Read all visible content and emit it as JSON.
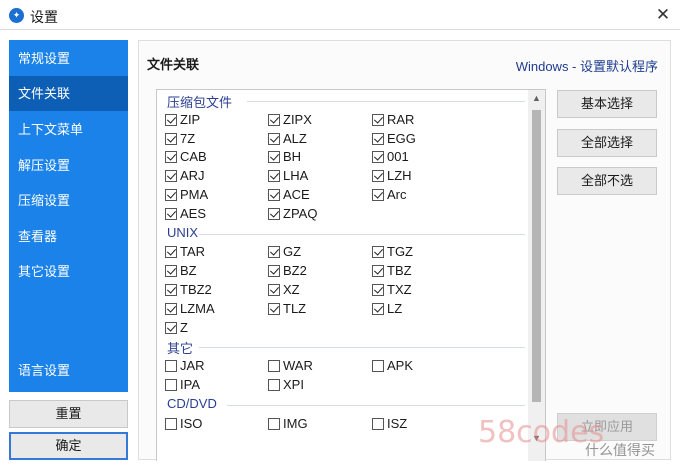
{
  "window": {
    "title": "设置",
    "close_glyph": "✕",
    "app_icon_glyph": "✦"
  },
  "sidebar": {
    "items": [
      {
        "label": "常规设置",
        "active": false
      },
      {
        "label": "文件关联",
        "active": true
      },
      {
        "label": "上下文菜单",
        "active": false
      },
      {
        "label": "解压设置",
        "active": false
      },
      {
        "label": "压缩设置",
        "active": false
      },
      {
        "label": "查看器",
        "active": false
      },
      {
        "label": "其它设置",
        "active": false
      }
    ],
    "language": "语言设置"
  },
  "buttons": {
    "reset": "重置",
    "ok": "确定",
    "basic_select": "基本选择",
    "select_all": "全部选择",
    "select_none": "全部不选",
    "apply": "立即应用"
  },
  "panel": {
    "title": "文件关联",
    "windows_link": "Windows - 设置默认程序"
  },
  "groups": [
    {
      "name": "压缩包文件",
      "items": [
        [
          "ZIP",
          true
        ],
        [
          "ZIPX",
          true
        ],
        [
          "RAR",
          true
        ],
        [
          "7Z",
          true
        ],
        [
          "ALZ",
          true
        ],
        [
          "EGG",
          true
        ],
        [
          "CAB",
          true
        ],
        [
          "BH",
          true
        ],
        [
          "001",
          true
        ],
        [
          "ARJ",
          true
        ],
        [
          "LHA",
          true
        ],
        [
          "LZH",
          true
        ],
        [
          "PMA",
          true
        ],
        [
          "ACE",
          true
        ],
        [
          "Arc",
          true
        ],
        [
          "AES",
          true
        ],
        [
          "ZPAQ",
          true
        ]
      ]
    },
    {
      "name": "UNIX",
      "items": [
        [
          "TAR",
          true
        ],
        [
          "GZ",
          true
        ],
        [
          "TGZ",
          true
        ],
        [
          "BZ",
          true
        ],
        [
          "BZ2",
          true
        ],
        [
          "TBZ",
          true
        ],
        [
          "TBZ2",
          true
        ],
        [
          "XZ",
          true
        ],
        [
          "TXZ",
          true
        ],
        [
          "LZMA",
          true
        ],
        [
          "TLZ",
          true
        ],
        [
          "LZ",
          true
        ],
        [
          "Z",
          true
        ]
      ]
    },
    {
      "name": "其它",
      "items": [
        [
          "JAR",
          false
        ],
        [
          "WAR",
          false
        ],
        [
          "APK",
          false
        ],
        [
          "IPA",
          false
        ],
        [
          "XPI",
          false
        ]
      ]
    },
    {
      "name": "CD/DVD",
      "items": [
        [
          "ISO",
          false
        ],
        [
          "IMG",
          false
        ],
        [
          "ISZ",
          false
        ]
      ]
    }
  ],
  "watermark": {
    "text": "58codes",
    "sub": "什么值得买"
  }
}
